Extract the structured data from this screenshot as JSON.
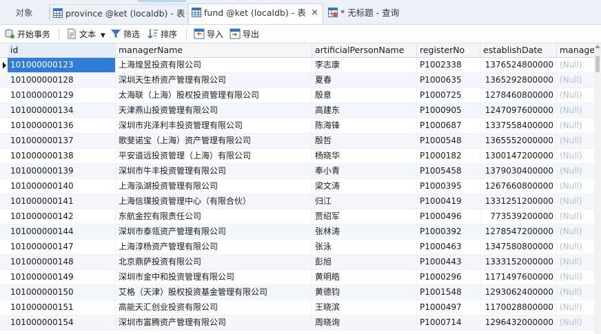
{
  "tabs": {
    "objects": "对象",
    "tab1": "province @ket (localdb) - 表",
    "tab2": "fund @ket (localdb) - 表",
    "tab3": "* 无标题 - 查询",
    "close": "×"
  },
  "toolbar": {
    "begin_transaction": "开始事务",
    "text": "文本",
    "filter": "筛选",
    "sort": "排序",
    "import": "导入",
    "export": "导出"
  },
  "columns": [
    "id",
    "managerName",
    "artificialPersonName",
    "registerNo",
    "establishDate",
    "managerT"
  ],
  "rows": [
    {
      "id": "101000000123",
      "managerName": "上海煌昱投资有限公司",
      "person": "李志康",
      "registerNo": "P1002338",
      "establishDate": "1376524800000",
      "extra": "(Null)"
    },
    {
      "id": "101000000128",
      "managerName": "深圳天生桥资产管理有限公司",
      "person": "夏春",
      "registerNo": "P1000635",
      "establishDate": "1365292800000",
      "extra": "(Null)"
    },
    {
      "id": "101000000129",
      "managerName": "太海联（上海）股权投资管理有限公司",
      "person": "殷意",
      "registerNo": "P1000725",
      "establishDate": "1278460800000",
      "extra": "(Null)"
    },
    {
      "id": "101000000134",
      "managerName": "天津燕山投资管理有限公司",
      "person": "高建东",
      "registerNo": "P1000905",
      "establishDate": "1247097600000",
      "extra": "(Null)"
    },
    {
      "id": "101000000136",
      "managerName": "深圳市兆泽利丰投资管理有限公司",
      "person": "陈海锋",
      "registerNo": "P1000687",
      "establishDate": "1337558400000",
      "extra": "(Null)"
    },
    {
      "id": "101000000137",
      "managerName": "歌斐诺宝（上海）资产管理有限公司",
      "person": "殷哲",
      "registerNo": "P1000548",
      "establishDate": "1365552000000",
      "extra": "(Null)"
    },
    {
      "id": "101000000138",
      "managerName": "平安道远投资管理（上海）有限公司",
      "person": "杨晓华",
      "registerNo": "P1000182",
      "establishDate": "1300147200000",
      "extra": "(Null)"
    },
    {
      "id": "101000000139",
      "managerName": "深圳市牛丰投资管理有限公司",
      "person": "奉小青",
      "registerNo": "P1005458",
      "establishDate": "1379030400000",
      "extra": "(Null)"
    },
    {
      "id": "101000000140",
      "managerName": "上海泓湖投资管理有限公司",
      "person": "梁文涛",
      "registerNo": "P1000395",
      "establishDate": "1267660800000",
      "extra": "(Null)"
    },
    {
      "id": "101000000141",
      "managerName": "上海信璞投资管理中心（有限合伙）",
      "person": "归江",
      "registerNo": "P1000419",
      "establishDate": "1331251200000",
      "extra": "(Null)"
    },
    {
      "id": "101000000142",
      "managerName": "东航金控有限责任公司",
      "person": "贾绍军",
      "registerNo": "P1000496",
      "establishDate": "773539200000",
      "extra": "(Null)"
    },
    {
      "id": "101000000144",
      "managerName": "深圳市泰瓴资产管理有限公司",
      "person": "张林涛",
      "registerNo": "P1000392",
      "establishDate": "1278547200000",
      "extra": "(Null)"
    },
    {
      "id": "101000000147",
      "managerName": "上海淳杨资产管理有限公司",
      "person": "张泳",
      "registerNo": "P1000463",
      "establishDate": "1347580800000",
      "extra": "(Null)"
    },
    {
      "id": "101000000148",
      "managerName": "北京鼎萨投资有限公司",
      "person": "彭旭",
      "registerNo": "P1000443",
      "establishDate": "1333152000000",
      "extra": "(Null)"
    },
    {
      "id": "101000000149",
      "managerName": "深圳市金中和投资管理有限公司",
      "person": "黄明皓",
      "registerNo": "P1000296",
      "establishDate": "1171497600000",
      "extra": "(Null)"
    },
    {
      "id": "101000000150",
      "managerName": "艾格（天津）股权投资基金管理有限公司",
      "person": "黄德钧",
      "registerNo": "P1001548",
      "establishDate": "1293062400000",
      "extra": "(Null)"
    },
    {
      "id": "101000000151",
      "managerName": "高能天汇创业投资有限公司",
      "person": "王晓滨",
      "registerNo": "P1000497",
      "establishDate": "1170028800000",
      "extra": "(Null)"
    },
    {
      "id": "101000000154",
      "managerName": "深圳市富腾资产管理有限公司",
      "person": "周晓询",
      "registerNo": "P1000714",
      "establishDate": "1296432000000",
      "extra": "(Null)"
    }
  ],
  "colors": {
    "selection": "#2f7bd6",
    "null_text": "#b8bcc4",
    "alt_row": "#f3f7fc"
  }
}
